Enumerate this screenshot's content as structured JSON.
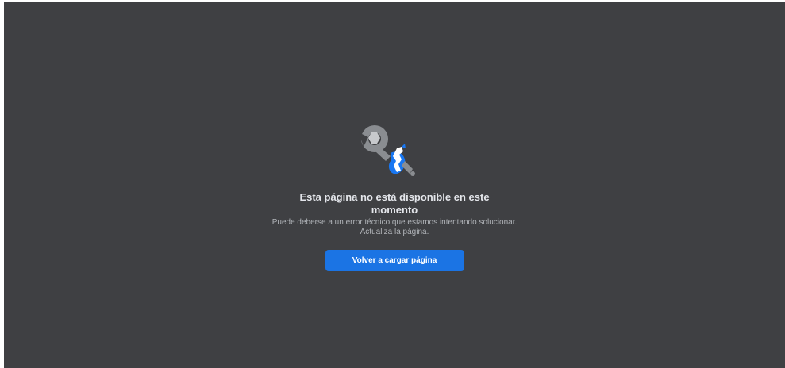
{
  "error_page": {
    "title": "Esta página no está disponible en este momento",
    "description": "Puede deberse a un error técnico que estamos intentando solucionar. Actualiza la página.",
    "reload_label": "Volver a cargar página",
    "illustration_icon": "broken-wrench-icon"
  },
  "colors": {
    "background": "#3f4043",
    "title": "#e4e6eb",
    "description": "#b0b3b8",
    "button": "#1b74e4",
    "button_text": "#ffffff",
    "wrench": "#8a8d91",
    "accent": "#1877f2"
  }
}
